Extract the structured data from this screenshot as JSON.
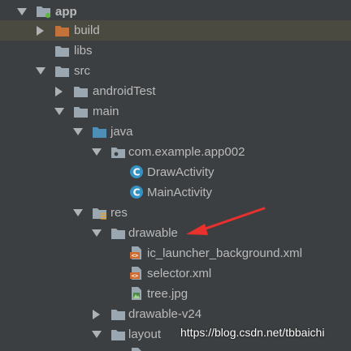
{
  "tree": {
    "app_label": "app",
    "build_label": "build",
    "libs_label": "libs",
    "src_label": "src",
    "androidtest_label": "androidTest",
    "main_label": "main",
    "java_label": "java",
    "package_label": "com.example.app002",
    "drawactivity_label": "DrawActivity",
    "mainactivity_label": "MainActivity",
    "res_label": "res",
    "drawable_label": "drawable",
    "ic_launcher_label": "ic_launcher_background.xml",
    "selector_label": "selector.xml",
    "tree_jpg_label": "tree.jpg",
    "drawable_v24_label": "drawable-v24",
    "layout_label": "layout"
  },
  "watermark": "https://blog.csdn.net/tbbaichi",
  "colors": {
    "background": "#3c3f41",
    "selected_row": "#4b4a40",
    "text": "#bbbbbb",
    "folder_gray": "#9aa7b0",
    "folder_orange": "#c3733a",
    "folder_blue": "#4e8fb8",
    "class_icon": "#3592c4",
    "xml_icon": "#d06a2f",
    "annotation_arrow": "#e8302d"
  }
}
